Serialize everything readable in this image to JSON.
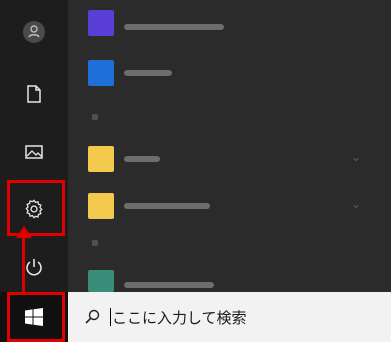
{
  "colors": {
    "rail": "#1d1d1d",
    "app_list": "#2b2b2b",
    "taskbar": "#101010",
    "search_box": "#f2f2f2",
    "annotation": "#e10000",
    "tile_purple": "#5a3fd6",
    "tile_blue": "#1e6fd8",
    "tile_yellow": "#f2c94c"
  },
  "rail": {
    "items": [
      {
        "name": "user-icon"
      },
      {
        "name": "document-icon"
      },
      {
        "name": "pictures-icon"
      },
      {
        "name": "gear-icon"
      },
      {
        "name": "power-icon"
      }
    ]
  },
  "taskbar": {
    "start_icon": "windows-logo-icon",
    "search": {
      "icon": "search-icon",
      "placeholder": "ここに入力して検索"
    }
  }
}
